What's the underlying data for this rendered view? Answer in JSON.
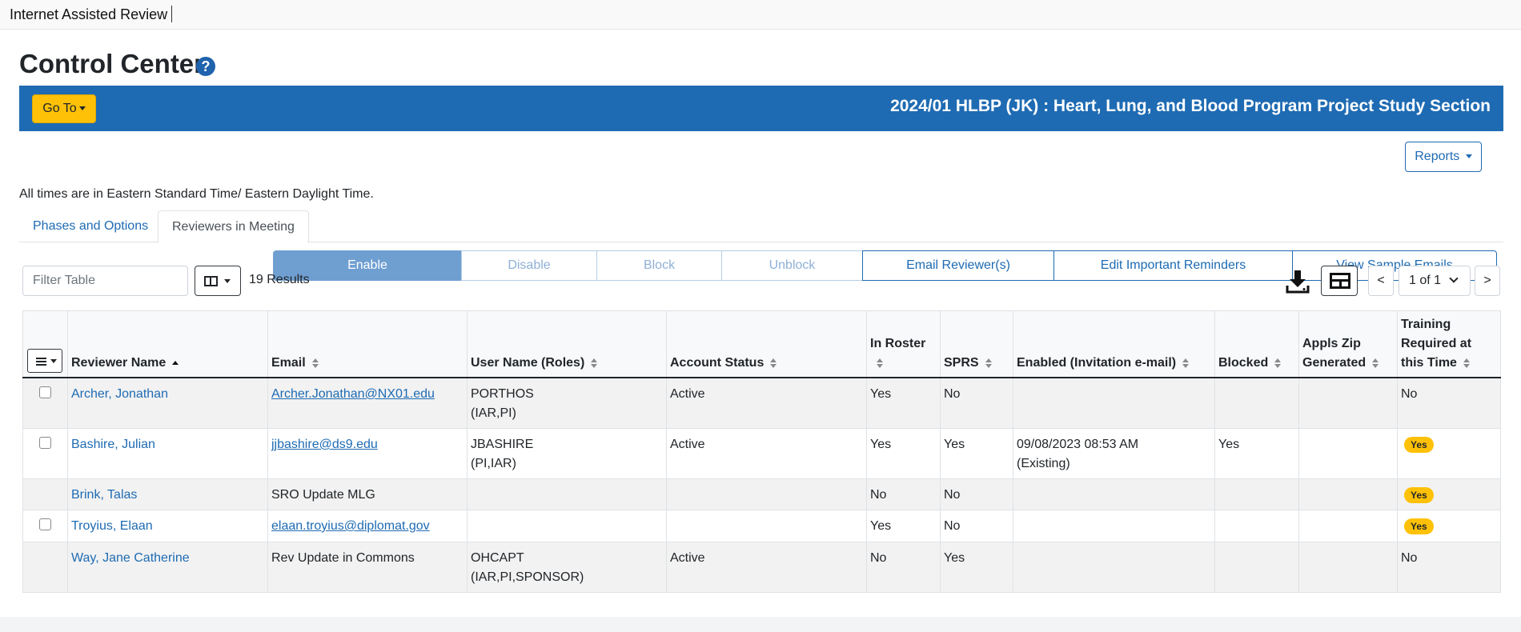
{
  "app": {
    "title": "Internet Assisted Review"
  },
  "page": {
    "title": "Control Center",
    "help_icon": "question-circle-icon"
  },
  "banner": {
    "goto_label": "Go To",
    "meeting_title": "2024/01 HLBP (JK) : Heart, Lung, and Blood Program Project Study Section",
    "color": "#1e6bb3",
    "goto_color": "#ffc107"
  },
  "reports_label": "Reports",
  "timezone_note": "All times are in Eastern Standard Time/ Eastern Daylight Time.",
  "tabs": [
    {
      "label": "Phases and Options",
      "active": false
    },
    {
      "label": "Reviewers in Meeting",
      "active": true
    }
  ],
  "actions": [
    {
      "label": "Enable",
      "state": "primary"
    },
    {
      "label": "Disable",
      "state": "disabled"
    },
    {
      "label": "Block",
      "state": "disabled"
    },
    {
      "label": "Unblock",
      "state": "disabled"
    },
    {
      "label": "Email Reviewer(s)",
      "state": "enabled"
    },
    {
      "label": "Edit Important Reminders",
      "state": "enabled"
    },
    {
      "label": "View Sample Emails",
      "state": "enabled"
    }
  ],
  "filter": {
    "placeholder": "Filter Table"
  },
  "results_text": "19 Results",
  "pagination": {
    "current": "1 of 1",
    "prev": "<",
    "next": ">"
  },
  "table": {
    "columns": [
      {
        "label": "Reviewer Name",
        "sorted": "asc"
      },
      {
        "label": "Email"
      },
      {
        "label": "User Name (Roles)"
      },
      {
        "label": "Account Status"
      },
      {
        "label": "In Roster"
      },
      {
        "label": "SPRS"
      },
      {
        "label": "Enabled (Invitation e-mail)"
      },
      {
        "label": "Blocked"
      },
      {
        "label": "Appls Zip Generated"
      },
      {
        "label": "Training Required at this Time"
      }
    ],
    "rows": [
      {
        "checkbox": true,
        "name": "Archer, Jonathan",
        "email": "Archer.Jonathan@NX01.edu",
        "email_link": true,
        "user": "PORTHOS",
        "roles": "(IAR,PI)",
        "status": "Active",
        "roster": "Yes",
        "sprs": "No",
        "enabled": "",
        "enabled_note": "",
        "blocked": "",
        "zip": "",
        "training": "No",
        "training_badge": false
      },
      {
        "checkbox": true,
        "name": "Bashire, Julian",
        "email": "jjbashire@ds9.edu",
        "email_link": true,
        "user": "JBASHIRE",
        "roles": "(PI,IAR)",
        "status": "Active",
        "roster": "Yes",
        "sprs": "Yes",
        "enabled": "09/08/2023 08:53 AM",
        "enabled_note": "(Existing)",
        "blocked": "Yes",
        "zip": "",
        "training": "Yes",
        "training_badge": true
      },
      {
        "checkbox": false,
        "name": "Brink, Talas",
        "email": "SRO Update MLG",
        "email_link": false,
        "user": "",
        "roles": "",
        "status": "",
        "roster": "No",
        "sprs": "No",
        "enabled": "",
        "enabled_note": "",
        "blocked": "",
        "zip": "",
        "training": "Yes",
        "training_badge": true
      },
      {
        "checkbox": true,
        "name": "Troyius, Elaan",
        "email": "elaan.troyius@diplomat.gov",
        "email_link": true,
        "user": "",
        "roles": "",
        "status": "",
        "roster": "Yes",
        "sprs": "No",
        "enabled": "",
        "enabled_note": "",
        "blocked": "",
        "zip": "",
        "training": "Yes",
        "training_badge": true
      },
      {
        "checkbox": false,
        "name": "Way, Jane Catherine",
        "email": "Rev Update in Commons",
        "email_link": false,
        "user": "OHCAPT",
        "roles": "(IAR,PI,SPONSOR)",
        "status": "Active",
        "roster": "No",
        "sprs": "Yes",
        "enabled": "",
        "enabled_note": "",
        "blocked": "",
        "zip": "",
        "training": "No",
        "training_badge": false
      }
    ]
  },
  "icons": {
    "download": "download-icon",
    "grid_view": "table-view-icon",
    "column_selector": "columns-icon",
    "row_menu": "hamburger-menu-icon"
  }
}
